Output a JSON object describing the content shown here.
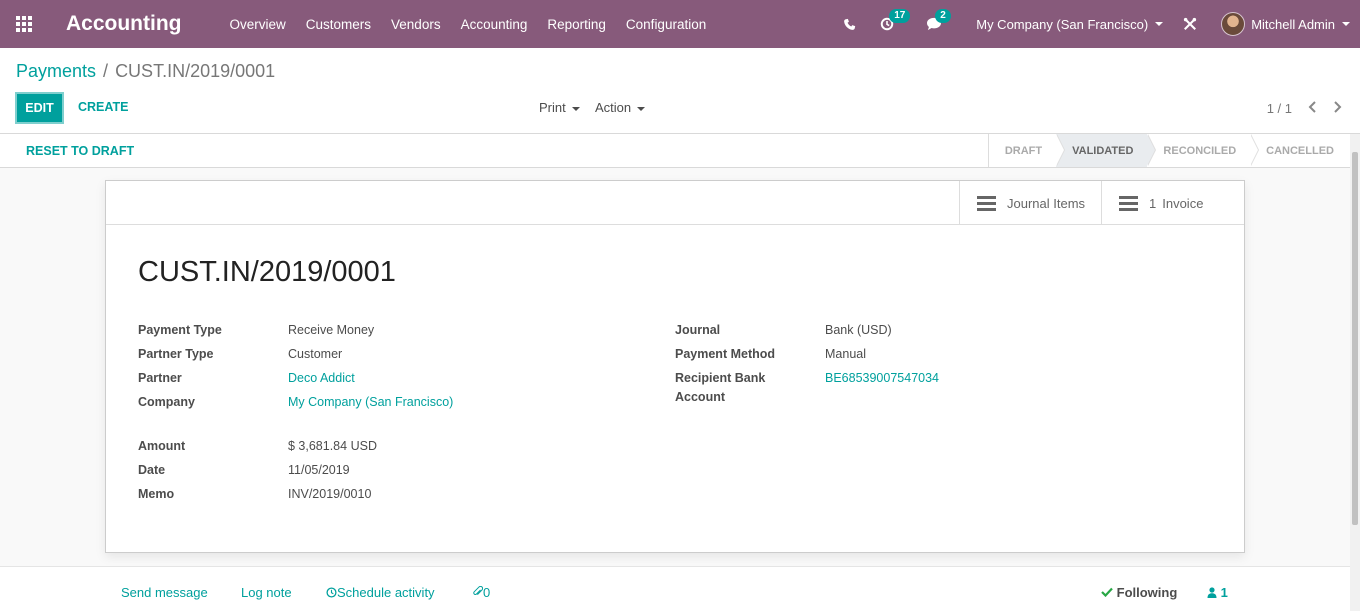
{
  "navbar": {
    "app_name": "Accounting",
    "menu": [
      "Overview",
      "Customers",
      "Vendors",
      "Accounting",
      "Reporting",
      "Configuration"
    ],
    "activity_count": "17",
    "message_count": "2",
    "company": "My Company (San Francisco)",
    "user": "Mitchell Admin",
    "icons": [
      "apps-icon",
      "phone-icon",
      "clock-icon",
      "chat-icon",
      "tools-icon"
    ]
  },
  "breadcrumb": {
    "parent": "Payments",
    "separator": "/",
    "current": "CUST.IN/2019/0001"
  },
  "toolbar": {
    "edit_label": "EDIT",
    "create_label": "CREATE",
    "print_label": "Print",
    "action_label": "Action",
    "pager": "1 / 1"
  },
  "statusbar": {
    "reset_label": "RESET TO DRAFT",
    "stages": [
      {
        "label": "DRAFT",
        "active": false
      },
      {
        "label": "VALIDATED",
        "active": true
      },
      {
        "label": "RECONCILED",
        "active": false
      },
      {
        "label": "CANCELLED",
        "active": false
      }
    ]
  },
  "smart_buttons": {
    "journal_items": "Journal Items",
    "invoice_count": "1",
    "invoice_label": "Invoice"
  },
  "form": {
    "title": "CUST.IN/2019/0001",
    "payment_type_label": "Payment Type",
    "payment_type": "Receive Money",
    "partner_type_label": "Partner Type",
    "partner_type": "Customer",
    "partner_label": "Partner",
    "partner": "Deco Addict",
    "company_label": "Company",
    "company": "My Company (San Francisco)",
    "amount_label": "Amount",
    "amount": "$ 3,681.84",
    "currency": "USD",
    "date_label": "Date",
    "date": "11/05/2019",
    "memo_label": "Memo",
    "memo": "INV/2019/0010",
    "journal_label": "Journal",
    "journal": "Bank (USD)",
    "payment_method_label": "Payment Method",
    "payment_method": "Manual",
    "recipient_bank_label_1": "Recipient Bank",
    "recipient_bank_label_2": "Account",
    "recipient_bank": "BE68539007547034"
  },
  "chatter": {
    "send_message": "Send message",
    "log_note": "Log note",
    "schedule_activity": "Schedule activity",
    "attachments": "0",
    "following": "Following",
    "followers": "1"
  },
  "colors": {
    "navbar": "#875a7b",
    "accent": "#00a09d"
  }
}
